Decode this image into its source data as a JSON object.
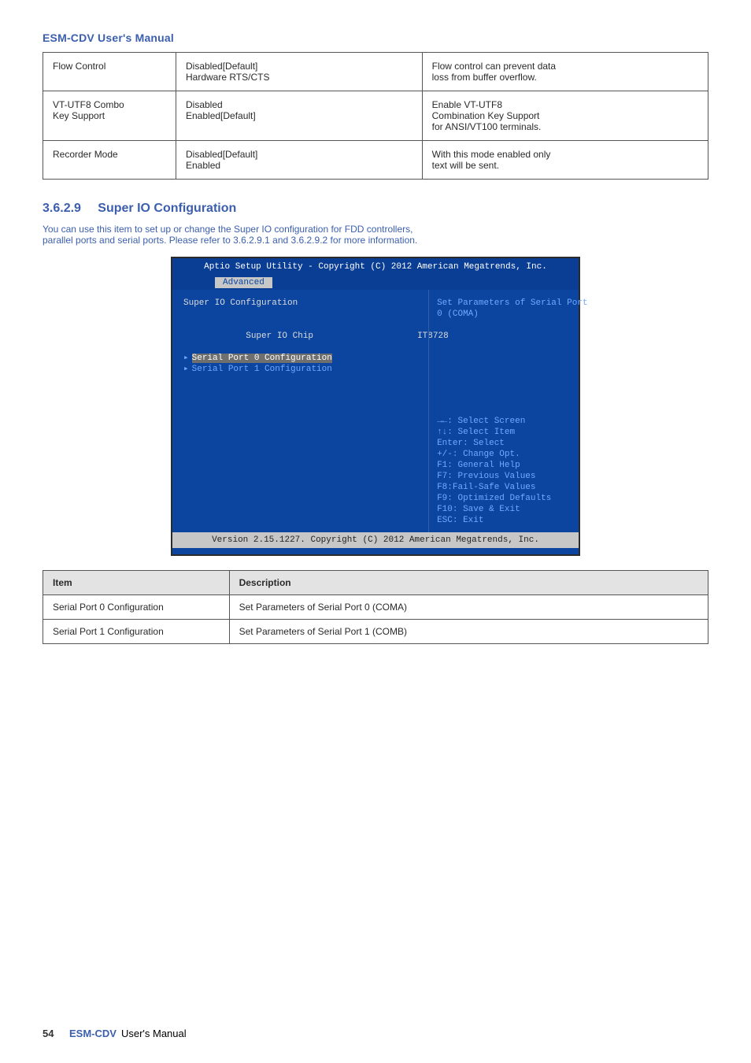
{
  "header": {
    "title": "ESM-CDV User's Manual"
  },
  "table1": {
    "rows": [
      {
        "c1": "Flow Control",
        "c2": "Disabled[Default]\nHardware RTS/CTS",
        "c3": "Flow control can prevent data\nloss from buffer overflow."
      },
      {
        "c1": "VT-UTF8 Combo\nKey Support",
        "c2": "Disabled\nEnabled[Default]",
        "c3": "Enable VT-UTF8\nCombination Key Support\nfor ANSI/VT100 terminals."
      },
      {
        "c1": "Recorder Mode",
        "c2": "Disabled[Default]\nEnabled",
        "c3": "With this mode enabled only\ntext will be sent."
      }
    ]
  },
  "section": {
    "number": "3.6.2.9",
    "title": "Super IO Configuration",
    "body": "You can use this item to set up or change the Super IO configuration for FDD controllers,\nparallel ports and serial ports. Please refer to 3.6.2.9.1 and 3.6.2.9.2 for more information."
  },
  "bios": {
    "titlebar": "Aptio Setup Utility - Copyright (C) 2012 American Megatrends, Inc.",
    "tab": "Advanced",
    "left": {
      "l1": "Super IO Configuration",
      "l2_label": "Super IO Chip",
      "l2_value": "IT8728",
      "l3": "Serial Port 0 Configuration",
      "l4": "Serial Port 1 Configuration"
    },
    "help": "Set Parameters of Serial Port\n0 (COMA)",
    "keys": "→←: Select Screen\n↑↓: Select Item\nEnter: Select\n+/-: Change Opt.\nF1: General Help\nF7: Previous Values\nF8:Fail-Safe Values\nF9: Optimized Defaults\nF10: Save & Exit\nESC: Exit",
    "footer": "Version 2.15.1227. Copyright (C) 2012 American Megatrends, Inc."
  },
  "table2": {
    "head": {
      "c1": "Item",
      "c2": "Description"
    },
    "rows": [
      {
        "c1": "Serial Port 0 Configuration",
        "c2": "Set Parameters of Serial Port 0 (COMA)"
      },
      {
        "c1": "Serial Port 1 Configuration",
        "c2": "Set Parameters of Serial Port 1 (COMB)"
      }
    ]
  },
  "footer": {
    "page": "54",
    "product": "ESM-CDV",
    "manual": "User's Manual"
  }
}
